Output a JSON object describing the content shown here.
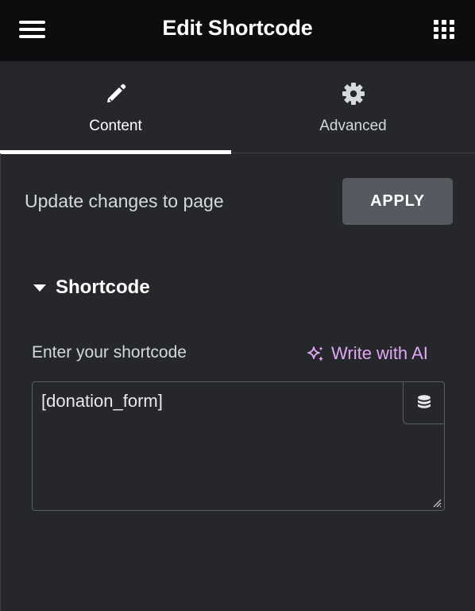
{
  "header": {
    "title": "Edit Shortcode",
    "menu_icon": "hamburger-menu-icon",
    "widgets_icon": "grid-icon"
  },
  "tabs": [
    {
      "label": "Content",
      "icon": "pencil-icon",
      "active": true
    },
    {
      "label": "Advanced",
      "icon": "gear-icon",
      "active": false
    }
  ],
  "apply_row": {
    "text": "Update changes to page",
    "button_label": "APPLY"
  },
  "section": {
    "title": "Shortcode",
    "expanded": true,
    "field_label": "Enter your shortcode",
    "ai_link_label": "Write with AI",
    "value": "[donation_form]",
    "dynamic_icon": "database-icon"
  },
  "colors": {
    "header_bg": "#0c0d0e",
    "panel_bg": "#26272b",
    "button_bg": "#555a61",
    "ai_accent": "#e0a8f5",
    "text": "#d5d8dc"
  }
}
